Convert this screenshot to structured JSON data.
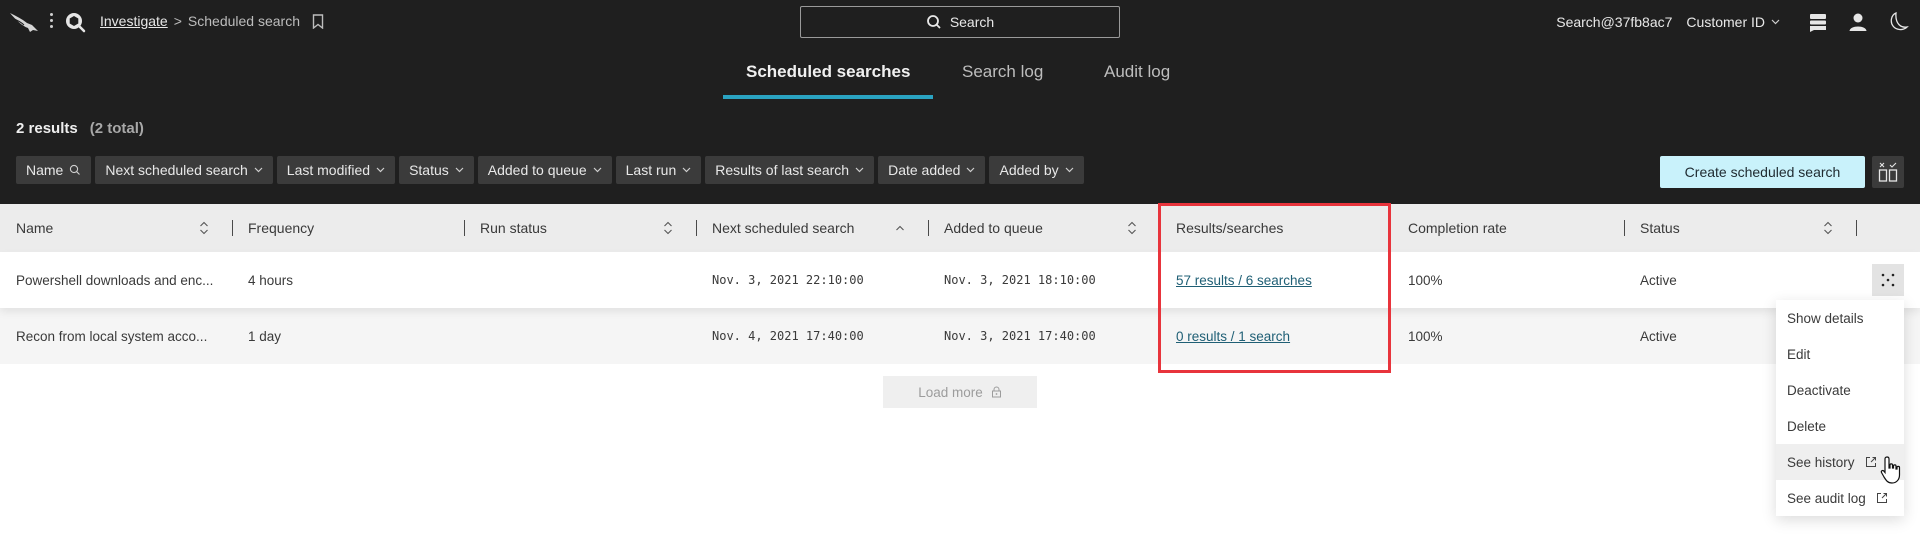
{
  "nav": {
    "breadcrumb_root": "Investigate",
    "breadcrumb_separator": ">",
    "breadcrumb_current": "Scheduled search",
    "search_label": "Search",
    "user": "Search@37fb8ac7",
    "customer_label": "Customer ID"
  },
  "tabs": [
    {
      "label": "Scheduled searches",
      "active": true
    },
    {
      "label": "Search log",
      "active": false
    },
    {
      "label": "Audit log",
      "active": false
    }
  ],
  "summary": {
    "results": "2 results",
    "total": "(2 total)"
  },
  "filters": [
    {
      "label": "Name",
      "icon": "search-icon"
    },
    {
      "label": "Next scheduled search",
      "icon": "chevron-down-icon"
    },
    {
      "label": "Last modified",
      "icon": "chevron-down-icon"
    },
    {
      "label": "Status",
      "icon": "chevron-down-icon"
    },
    {
      "label": "Added to queue",
      "icon": "chevron-down-icon"
    },
    {
      "label": "Last run",
      "icon": "chevron-down-icon"
    },
    {
      "label": "Results of last search",
      "icon": "chevron-down-icon"
    },
    {
      "label": "Date added",
      "icon": "chevron-down-icon"
    },
    {
      "label": "Added by",
      "icon": "chevron-down-icon"
    }
  ],
  "actions": {
    "create_label": "Create scheduled search"
  },
  "table": {
    "columns": [
      {
        "label": "Name",
        "sort": "both"
      },
      {
        "label": "Frequency",
        "sort": "none"
      },
      {
        "label": "Run status",
        "sort": "both"
      },
      {
        "label": "Next scheduled search",
        "sort": "asc"
      },
      {
        "label": "Added to queue",
        "sort": "both"
      },
      {
        "label": "Results/searches",
        "sort": "none"
      },
      {
        "label": "Completion rate",
        "sort": "none"
      },
      {
        "label": "Status",
        "sort": "both"
      }
    ],
    "rows": [
      {
        "name": "Powershell downloads and enc...",
        "frequency": "4 hours",
        "run_status": "",
        "next_scheduled": "Nov. 3, 2021 22:10:00",
        "added_to_queue": "Nov. 3, 2021 18:10:00",
        "results_searches": "57 results / 6 searches",
        "completion_rate": "100%",
        "status": "Active"
      },
      {
        "name": "Recon from local system acco...",
        "frequency": "1 day",
        "run_status": "",
        "next_scheduled": "Nov. 4, 2021 17:40:00",
        "added_to_queue": "Nov. 3, 2021 17:40:00",
        "results_searches": "0 results / 1 search",
        "completion_rate": "100%",
        "status": "Active"
      }
    ],
    "load_more_label": "Load more"
  },
  "row_menu": {
    "items": [
      {
        "label": "Show details",
        "external": false
      },
      {
        "label": "Edit",
        "external": false
      },
      {
        "label": "Deactivate",
        "external": false
      },
      {
        "label": "Delete",
        "external": false
      },
      {
        "label": "See history",
        "external": true,
        "hovered": true
      },
      {
        "label": "See audit log",
        "external": true
      }
    ]
  },
  "colors": {
    "accent_tab": "#2aa3c1",
    "primary_button": "#c9f2fb",
    "highlight": "#e8343c",
    "link": "#1f5f75"
  }
}
